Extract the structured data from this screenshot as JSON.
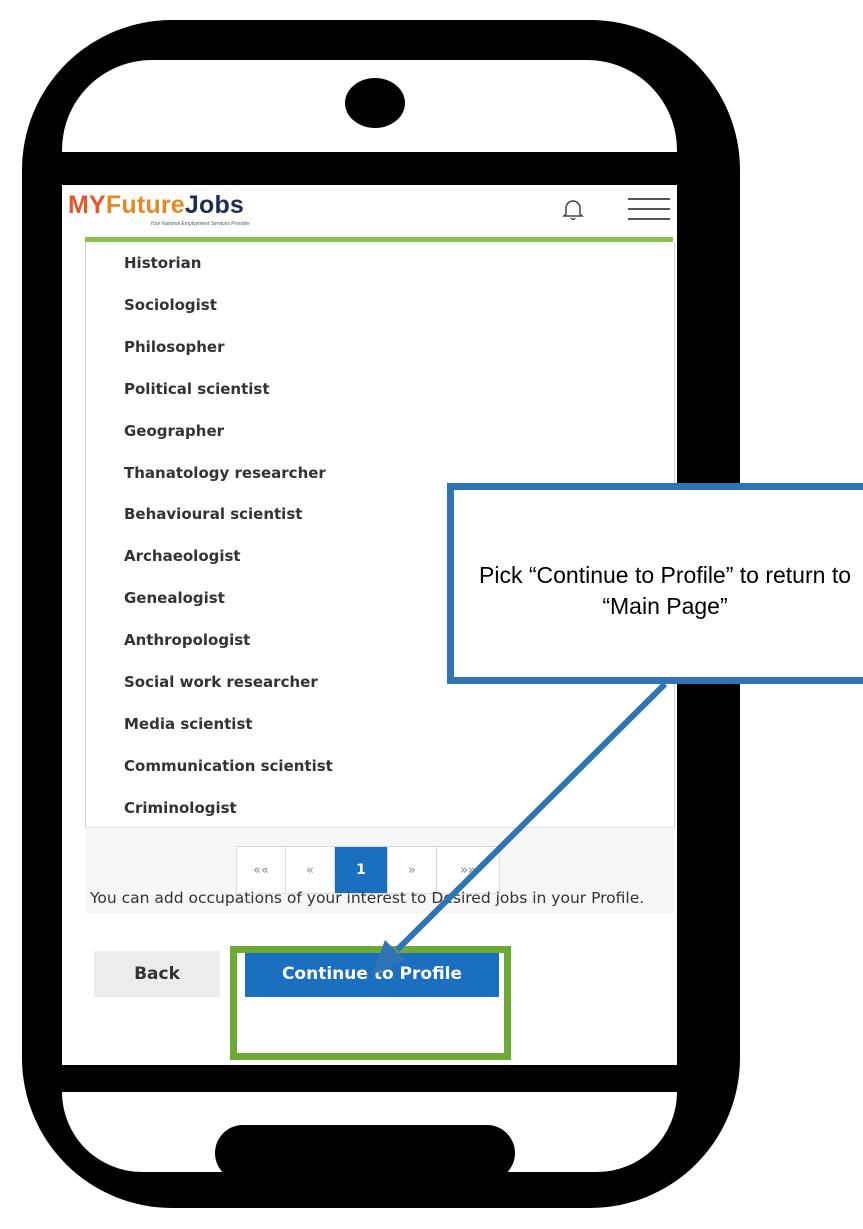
{
  "app": {
    "logo_my": "MY",
    "logo_future": "Future",
    "logo_jobs": "Jobs",
    "logo_tagline": "Your National Employment Services Provider",
    "icons": [
      "bell-icon",
      "menu-icon"
    ]
  },
  "jobs": [
    "Historian",
    "Sociologist",
    "Philosopher",
    "Political scientist",
    "Geographer",
    "Thanatology researcher",
    "Behavioural scientist",
    "Archaeologist",
    "Genealogist",
    "Anthropologist",
    "Social work researcher",
    "Media scientist",
    "Communication scientist",
    "Criminologist"
  ],
  "pagination": {
    "first": "««",
    "prev": "«",
    "current": "1",
    "next": "»",
    "last": "»»"
  },
  "footer": {
    "note": "You can add occupations of your interest to Desired jobs in your Profile.",
    "back_label": "Back",
    "continue_label": "Continue to Profile"
  },
  "callout": {
    "text": "Pick “Continue to Profile” to return to “Main Page”"
  },
  "colors": {
    "accent_blue": "#1b6fbf",
    "highlight_green": "#6aaa35",
    "callout_border": "#2f74b5",
    "header_rule": "#8dc04f"
  }
}
